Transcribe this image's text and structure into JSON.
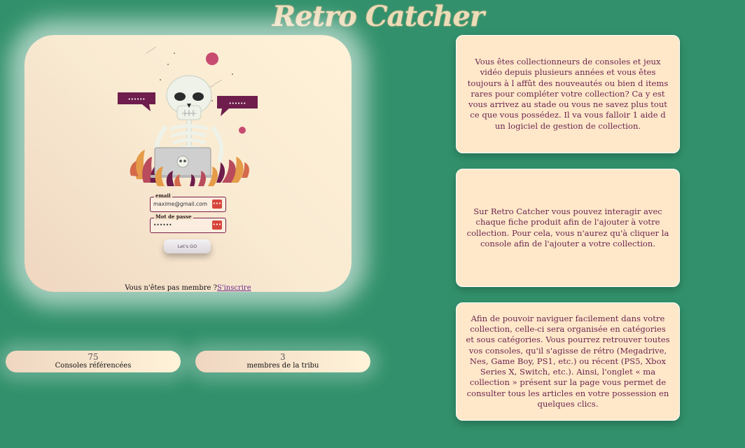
{
  "app": {
    "title": "Retro Catcher"
  },
  "login": {
    "email_label": "email",
    "email_value": "maxime@gmail.com",
    "password_label": "Mot de passe",
    "password_value": "••••••",
    "toggle_glyph": "•••",
    "submit_label": "Let's GO",
    "signup_prompt": "Vous n'êtes pas membre ?",
    "signup_link": "S'inscrire",
    "speech_bubble_text": "••••••"
  },
  "stats": [
    {
      "value": "75",
      "label": "Consoles référencées"
    },
    {
      "value": "3",
      "label": "membres de la tribu"
    }
  ],
  "info_cards": [
    {
      "text": "Vous êtes collectionneurs de consoles et jeux vidéo depuis plusieurs années et vous êtes toujours à l affût des nouveautés ou bien d items rares pour compléter votre collection? Ca y est vous arrivez au stade ou vous ne savez plus tout ce que vous possédez. Il va vous falloir 1 aide d un logiciel de gestion de collection."
    },
    {
      "text": "Sur Retro Catcher vous pouvez interagir avec chaque fiche produit afin de l'ajouter à votre collection. Pour cela, vous n'aurez qu'à cliquer la console afin de l'ajouter a votre collection."
    },
    {
      "text": "Afin de pouvoir naviguer facilement dans votre collection, celle-ci sera organisée en catégories et sous catégories. Vous pourrez retrouver toutes vos consoles, qu'il s'agisse de rétro (Megadrive, Nes, Game Boy, PS1, etc.) ou récent (PS5, Xbox Series X, Switch, etc.). Ainsi, l'onglet « ma collection » présent sur la page vous permet de consulter tous les articles en votre possession en quelques clics."
    }
  ],
  "colors": {
    "background": "#32916c",
    "card": "#ffe8c9",
    "accent": "#6b2450",
    "bubble": "#6e1d4c",
    "button_red": "#d8453c"
  },
  "icons": {
    "illustration": "skeleton-with-laptop-icon",
    "password_toggle": "eye-icon"
  }
}
